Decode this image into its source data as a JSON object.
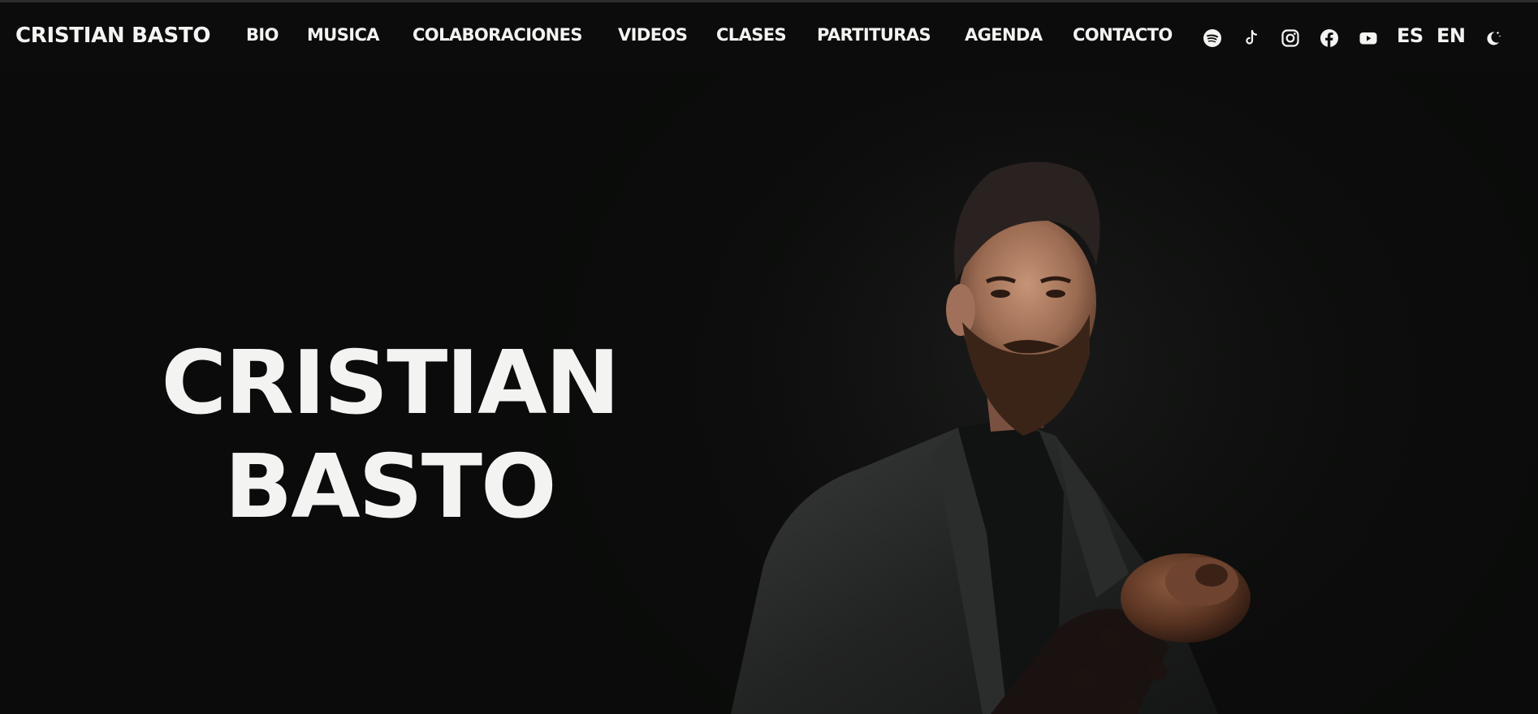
{
  "site": {
    "brand": "CRISTIAN BASTO"
  },
  "nav": {
    "items": [
      {
        "label": "BIO"
      },
      {
        "label": "MUSICA"
      },
      {
        "label": "COLABORACIONES"
      },
      {
        "label": "VIDEOS"
      },
      {
        "label": "CLASES"
      },
      {
        "label": "PARTITURAS"
      },
      {
        "label": "AGENDA"
      },
      {
        "label": "CONTACTO"
      }
    ],
    "social_icons": [
      "spotify-icon",
      "tiktok-icon",
      "instagram-icon",
      "facebook-icon",
      "youtube-icon"
    ],
    "languages": {
      "es": "ES",
      "en": "EN"
    },
    "theme_toggle_icon": "moon-icon"
  },
  "hero": {
    "title_line1": "CRISTIAN",
    "title_line2": "BASTO",
    "image": "portrait of a bearded cellist in a dark suit holding the scroll of a cello"
  },
  "colors": {
    "background": "#0b0c0b",
    "text": "#f4f4f2"
  }
}
